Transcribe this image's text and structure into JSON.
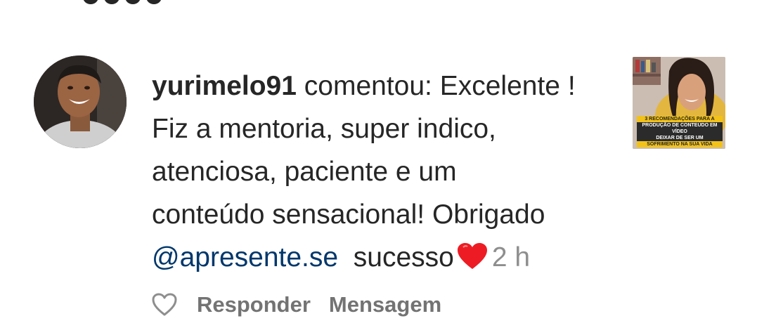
{
  "comment": {
    "username": "yurimelo91",
    "verb": " comentou: ",
    "line1_text": "Excelente !",
    "line2": "Fiz a mentoria, super indico,",
    "line3": "atenciosa, paciente e um",
    "line4": "conteúdo sensacional! Obrigado",
    "mention": "@apresente.se",
    "after_mention": "  sucesso",
    "emoji": "heart-emoji",
    "time": "2 h"
  },
  "actions": {
    "reply_label": "Responder",
    "message_label": "Mensagem",
    "like_icon": "heart-outline-icon"
  },
  "thumbnail": {
    "caption_l1": "3 RECOMENDAÇÕES PARA A",
    "caption_l2": "PRODUÇÃO DE CONTEÚDO EM VÍDEO",
    "caption_l3": "DEIXAR DE SER UM",
    "caption_l4": "SOFRIMENTO NA SUA VIDA"
  },
  "colors": {
    "text": "#262626",
    "mention": "#00376b",
    "secondary": "#8e8e8e",
    "heart": "#ed1c24"
  }
}
